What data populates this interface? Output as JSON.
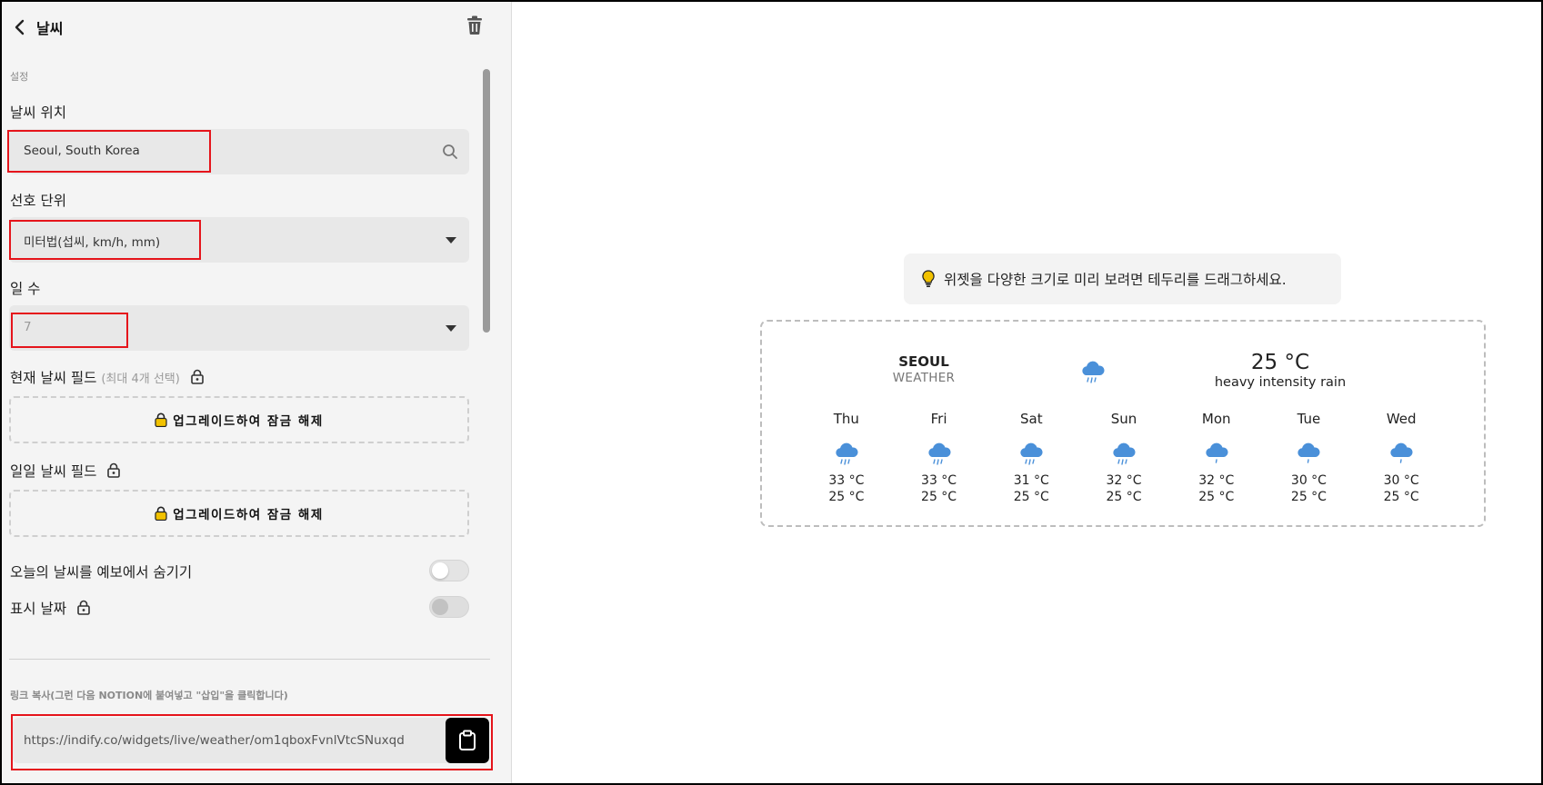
{
  "header": {
    "title": "날씨"
  },
  "settings": {
    "caption": "설정",
    "location": {
      "label": "날씨 위치",
      "value": "Seoul, South Korea"
    },
    "units": {
      "label": "선호 단위",
      "value": "미터법(섭씨, km/h, mm)"
    },
    "days": {
      "label": "일 수",
      "value": "7"
    },
    "current_fields": {
      "label": "현재 날씨 필드",
      "hint": "(최대 4개 선택)",
      "upgrade_label": "업그레이드하여 잠금 해제"
    },
    "daily_fields": {
      "label": "일일 날씨 필드",
      "upgrade_label": "업그레이드하여 잠금 해제"
    },
    "hide_today": {
      "label": "오늘의 날씨를 예보에서 숨기기",
      "on": false
    },
    "show_date": {
      "label": "표시 날짜",
      "on": false,
      "locked": true
    }
  },
  "link": {
    "caption": "링크 복사(그런 다음 NOTION에 붙여넣고 \"삽입\"을 클릭합니다)",
    "url": "https://indify.co/widgets/live/weather/om1qboxFvnlVtcSNuxqd"
  },
  "preview": {
    "tip": "위젯을 다양한 크기로 미리 보려면 테두리를 드래그하세요.",
    "city": "SEOUL",
    "city_sub": "WEATHER",
    "current_temp": "25 °C",
    "current_desc": "heavy intensity rain",
    "current_icon": "rain-cloud-icon",
    "forecast": [
      {
        "day": "Thu",
        "hi": "33 °C",
        "lo": "25 °C",
        "icon": "rain-cloud-icon"
      },
      {
        "day": "Fri",
        "hi": "33 °C",
        "lo": "25 °C",
        "icon": "rain-cloud-icon"
      },
      {
        "day": "Sat",
        "hi": "31 °C",
        "lo": "25 °C",
        "icon": "rain-cloud-icon"
      },
      {
        "day": "Sun",
        "hi": "32 °C",
        "lo": "25 °C",
        "icon": "rain-cloud-icon"
      },
      {
        "day": "Mon",
        "hi": "32 °C",
        "lo": "25 °C",
        "icon": "light-rain-cloud-icon"
      },
      {
        "day": "Tue",
        "hi": "30 °C",
        "lo": "25 °C",
        "icon": "light-rain-cloud-icon"
      },
      {
        "day": "Wed",
        "hi": "30 °C",
        "lo": "25 °C",
        "icon": "light-rain-cloud-icon"
      }
    ]
  },
  "colors": {
    "highlight": "#e5141b",
    "icon_blue": "#4a90d9",
    "lock_yellow": "#f2c200",
    "copy_button": "#000000"
  }
}
